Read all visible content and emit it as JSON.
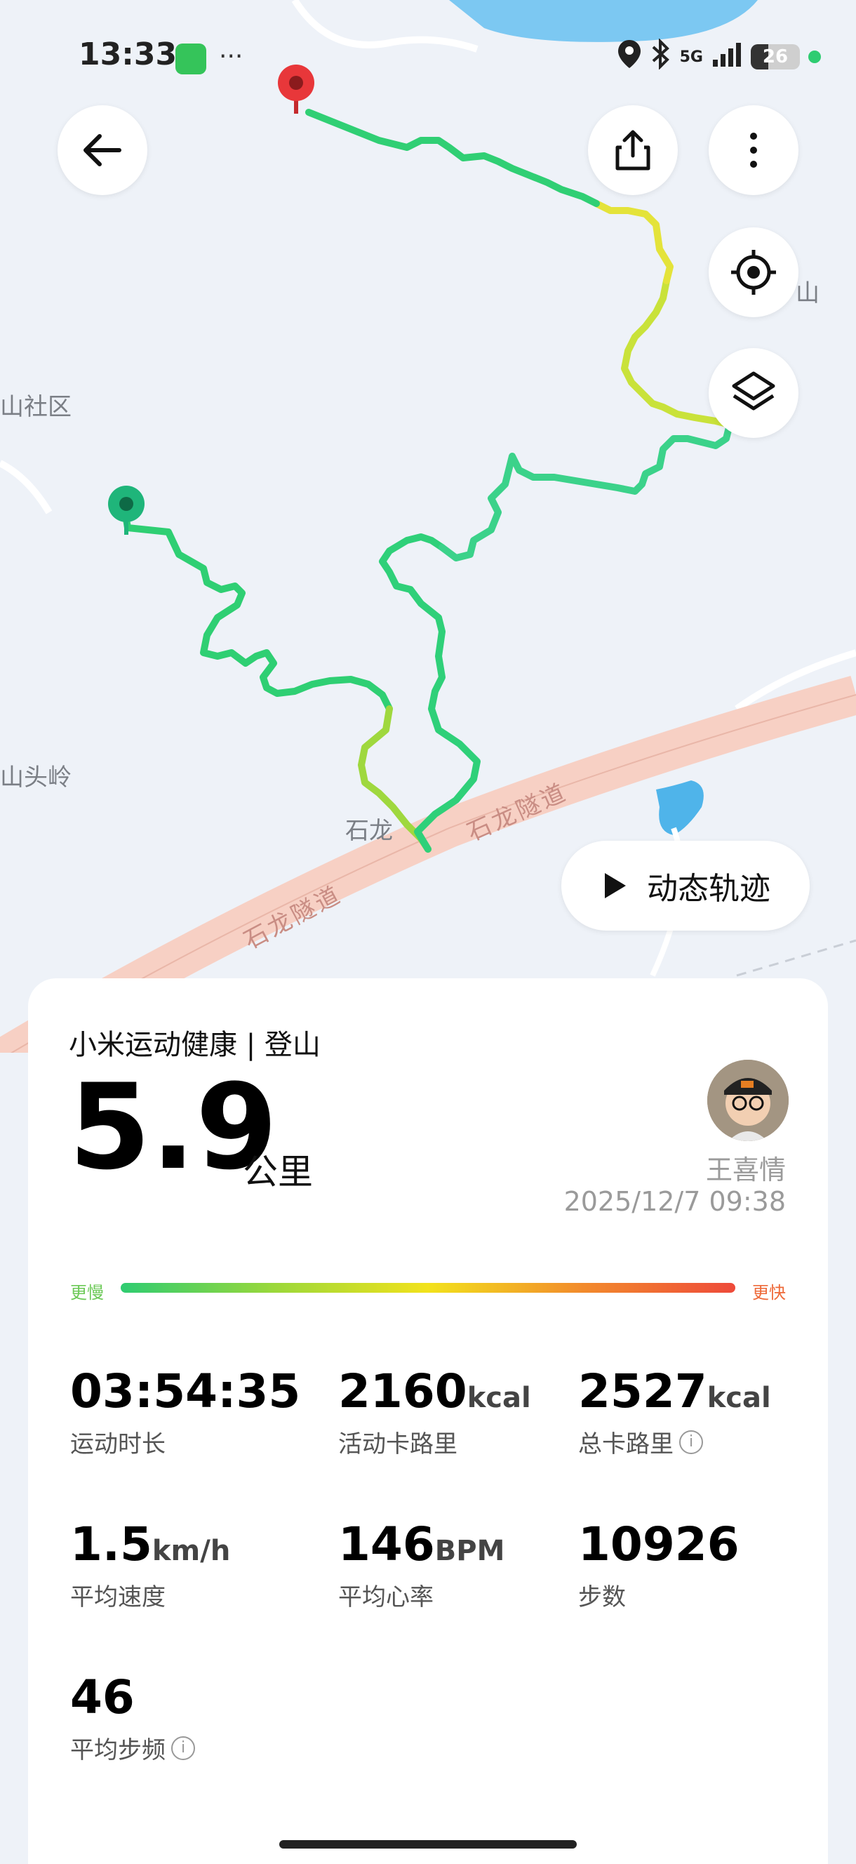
{
  "status_bar": {
    "time": "13:33",
    "dots": "···",
    "network": "5G",
    "battery": "26"
  },
  "map": {
    "labels": {
      "community": "山社区",
      "ridge": "山头岭",
      "village": "石龙",
      "mountain": "山"
    },
    "road_name": "石龙隧道"
  },
  "controls": {
    "replay_label": "动态轨迹"
  },
  "card": {
    "title": "小米运动健康 | 登山",
    "distance": "5.9",
    "distance_unit": "公里",
    "user_name": "王喜情",
    "date": "2025/12/7 09:38",
    "pace_slow": "更慢",
    "pace_fast": "更快",
    "stats": [
      {
        "value": "03:54:35",
        "unit": "",
        "label": "运动时长",
        "info": false
      },
      {
        "value": "2160",
        "unit": "kcal",
        "label": "活动卡路里",
        "info": false
      },
      {
        "value": "2527",
        "unit": "kcal",
        "label": "总卡路里",
        "info": true
      },
      {
        "value": "1.5",
        "unit": "km/h",
        "label": "平均速度",
        "info": false
      },
      {
        "value": "146",
        "unit": "BPM",
        "label": "平均心率",
        "info": false
      },
      {
        "value": "10926",
        "unit": "",
        "label": "步数",
        "info": false
      },
      {
        "value": "46",
        "unit": "",
        "label": "平均步频",
        "info": true
      }
    ],
    "info_glyph": "i"
  },
  "colors": {
    "track_start": "#2ecc71",
    "track_mid": "#d8e23a",
    "start_pin": "#1fb57a",
    "end_pin": "#e8373a"
  }
}
